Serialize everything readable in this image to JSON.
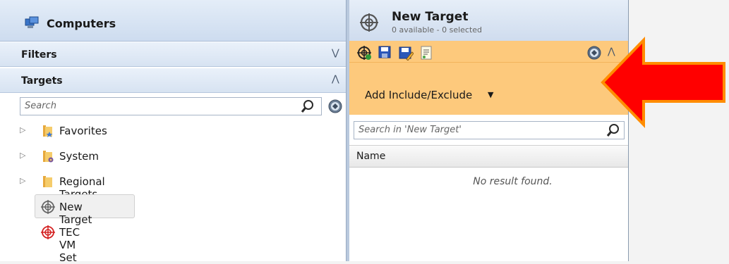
{
  "left_pane": {
    "title": "Computers",
    "filters_label": "Filters",
    "targets_label": "Targets",
    "search_placeholder": "Search",
    "tree": [
      {
        "label": "Favorites",
        "icon": "folder-star-icon",
        "expandable": true
      },
      {
        "label": "System",
        "icon": "folder-gear-icon",
        "expandable": true
      },
      {
        "label": "Regional Targets",
        "icon": "folder-icon",
        "expandable": true
      },
      {
        "label": "New Target",
        "icon": "target-gray-icon",
        "selected": true
      },
      {
        "label": "TEC VM Set",
        "icon": "target-red-icon"
      }
    ]
  },
  "right_pane": {
    "title": "New Target",
    "subtitle": "0 available - 0 selected",
    "add_include_exclude_label": "Add Include/Exclude",
    "search_placeholder": "Search in 'New Target'",
    "column_name": "Name",
    "empty_message": "No result found."
  },
  "colors": {
    "toolbar_highlight": "#fdc97c",
    "callout_arrow": "#ff0000"
  }
}
